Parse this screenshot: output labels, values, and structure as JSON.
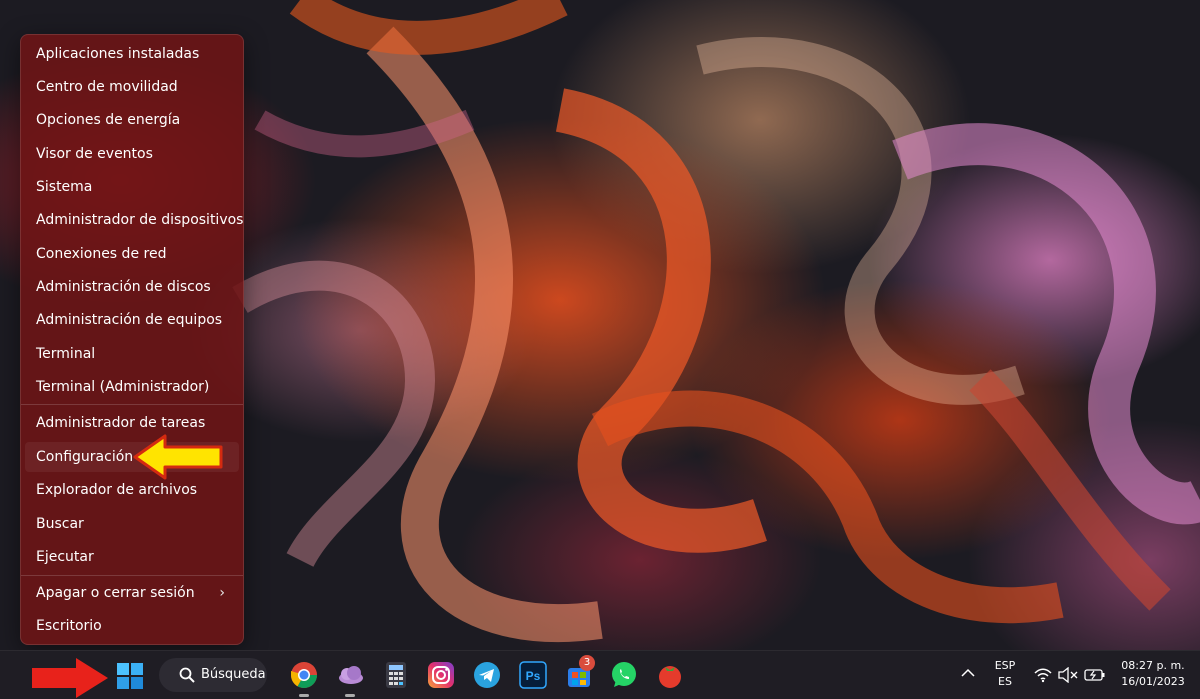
{
  "menu": {
    "items": [
      {
        "label": "Aplicaciones instaladas"
      },
      {
        "label": "Centro de movilidad"
      },
      {
        "label": "Opciones de energía"
      },
      {
        "label": "Visor de eventos"
      },
      {
        "label": "Sistema"
      },
      {
        "label": "Administrador de dispositivos"
      },
      {
        "label": "Conexiones de red"
      },
      {
        "label": "Administración de discos"
      },
      {
        "label": "Administración de equipos"
      },
      {
        "label": "Terminal"
      },
      {
        "label": "Terminal (Administrador)"
      },
      {
        "label": "Administrador de tareas"
      },
      {
        "label": "Configuración"
      },
      {
        "label": "Explorador de archivos"
      },
      {
        "label": "Buscar"
      },
      {
        "label": "Ejecutar"
      },
      {
        "label": "Apagar o cerrar sesión"
      },
      {
        "label": "Escritorio"
      }
    ],
    "highlighted": "Configuración"
  },
  "taskbar": {
    "search_label": "Búsqueda",
    "apps": [
      {
        "name": "chrome-icon"
      },
      {
        "name": "onedrive-icon"
      },
      {
        "name": "calculator-icon"
      },
      {
        "name": "instagram-icon"
      },
      {
        "name": "telegram-icon"
      },
      {
        "name": "photoshop-icon",
        "text": "Ps"
      },
      {
        "name": "store-icon",
        "badge": "3"
      },
      {
        "name": "whatsapp-icon"
      },
      {
        "name": "tomato-icon"
      }
    ],
    "tray": {
      "lang_top": "ESP",
      "lang_bottom": "ES",
      "time": "08:27 p. m.",
      "date": "16/01/2023"
    }
  },
  "colors": {
    "menu_bg": "#6e1416",
    "taskbar_bg": "#1f1d24",
    "arrow_yellow": "#ffe400",
    "arrow_red": "#e8221b",
    "windows_blue": "#4cc2ff"
  }
}
